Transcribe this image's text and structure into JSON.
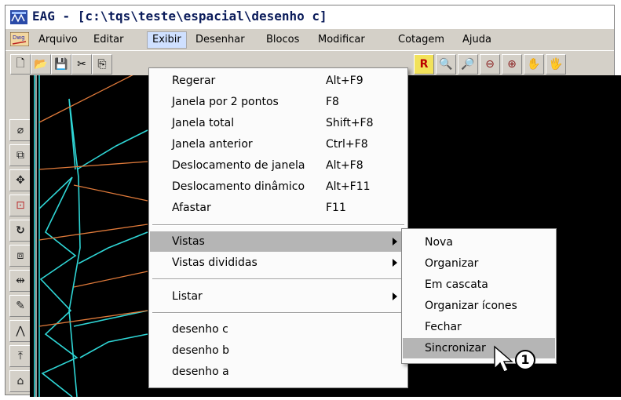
{
  "window": {
    "title": "EAG - [c:\\tqs\\teste\\espacial\\desenho c]"
  },
  "menubar": {
    "items": [
      {
        "label": "Arquivo"
      },
      {
        "label": "Editar"
      },
      {
        "label": "Exibir"
      },
      {
        "label": "Desenhar"
      },
      {
        "label": "Blocos"
      },
      {
        "label": "Modificar"
      },
      {
        "label": "Cotagem"
      },
      {
        "label": "Ajuda"
      }
    ],
    "active": "Exibir"
  },
  "exibir_menu": {
    "items": [
      {
        "label": "Regerar",
        "shortcut": "Alt+F9"
      },
      {
        "label": "Janela por 2 pontos",
        "shortcut": "F8"
      },
      {
        "label": "Janela total",
        "shortcut": "Shift+F8"
      },
      {
        "label": "Janela anterior",
        "shortcut": "Ctrl+F8"
      },
      {
        "label": "Deslocamento de janela",
        "shortcut": "Alt+F8"
      },
      {
        "label": "Deslocamento dinâmico",
        "shortcut": "Alt+F11"
      },
      {
        "label": "Afastar",
        "shortcut": "F11"
      },
      {
        "label": "Vistas",
        "shortcut": ""
      },
      {
        "label": "Vistas divididas",
        "shortcut": ""
      },
      {
        "label": "Listar",
        "shortcut": ""
      },
      {
        "label": "desenho c",
        "shortcut": ""
      },
      {
        "label": "desenho b",
        "shortcut": ""
      },
      {
        "label": "desenho a",
        "shortcut": ""
      }
    ]
  },
  "vistas_submenu": {
    "items": [
      {
        "label": "Nova"
      },
      {
        "label": "Organizar"
      },
      {
        "label": "Em cascata"
      },
      {
        "label": "Organizar ícones"
      },
      {
        "label": "Fechar"
      },
      {
        "label": "Sincronizar"
      }
    ]
  },
  "callout": {
    "number": "1"
  },
  "toolbar": {
    "r_button_label": "R"
  },
  "colors": {
    "drawing_bg": "#000000",
    "cyan_lines": "#2fd6d6",
    "orange_lines": "#e07a3a",
    "menu_highlight": "#b5b5b5"
  }
}
